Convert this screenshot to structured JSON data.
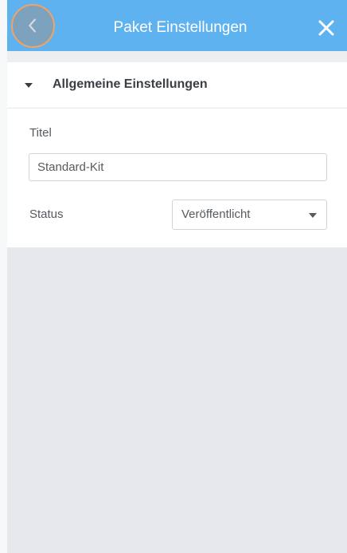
{
  "header": {
    "title": "Paket Einstellungen",
    "back_icon": "chevron-left-icon",
    "close_icon": "close-icon",
    "background_color": "#5eb2f0"
  },
  "section": {
    "title": "Allgemeine Einstellungen",
    "expanded": true
  },
  "fields": {
    "titel_label": "Titel",
    "titel_value": "Standard-Kit",
    "status_label": "Status",
    "status_value": "Veröffentlicht"
  }
}
